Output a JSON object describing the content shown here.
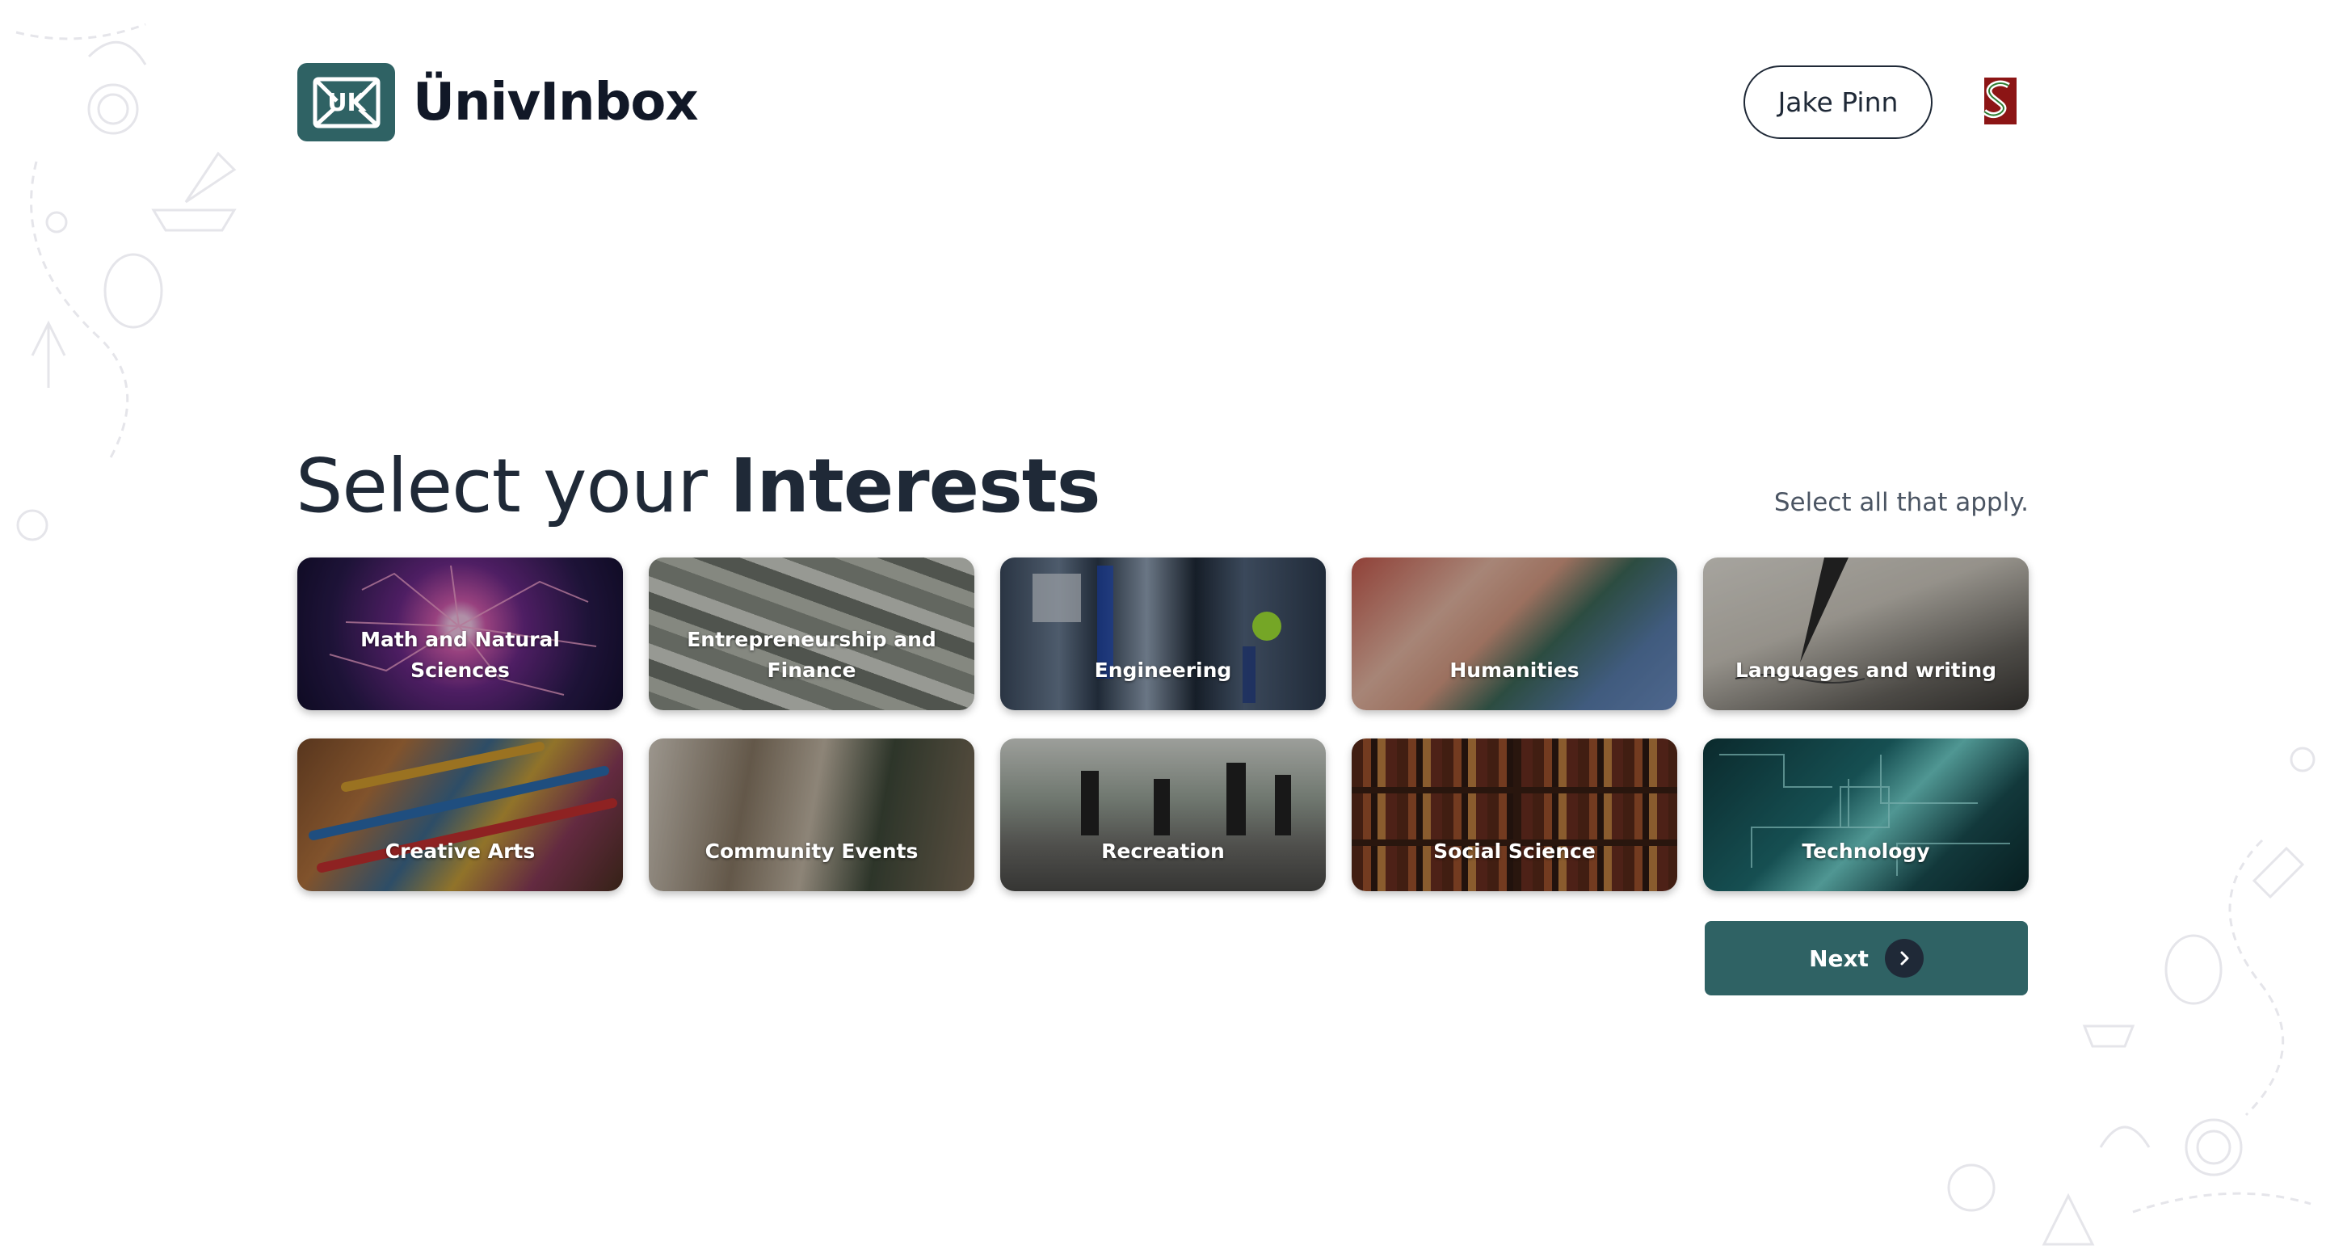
{
  "app": {
    "logo_text": "ÜnivInbox",
    "logo_icon": "envelope-uk-icon"
  },
  "header": {
    "user_name": "Jake Pinn",
    "school_logo": "stanford-s-logo-icon"
  },
  "page": {
    "title_prefix": "Select your ",
    "title_bold": "Interests",
    "hint": "Select all that apply."
  },
  "interests": [
    {
      "label": "Math and Natural Sciences",
      "image": "plasma-ball"
    },
    {
      "label": "Entrepreneurship and Finance",
      "image": "dollar-bills"
    },
    {
      "label": "Engineering",
      "image": "lab-machinery"
    },
    {
      "label": "Humanities",
      "image": "stacked-hands"
    },
    {
      "label": "Languages and writing",
      "image": "fountain-pen-writing"
    },
    {
      "label": "Creative Arts",
      "image": "paint-brushes"
    },
    {
      "label": "Community Events",
      "image": "people-at-table"
    },
    {
      "label": "Recreation",
      "image": "people-running"
    },
    {
      "label": "Social Science",
      "image": "bookshelves"
    },
    {
      "label": "Technology",
      "image": "circuit-board"
    }
  ],
  "actions": {
    "next_label": "Next",
    "next_icon": "chevron-right-icon"
  },
  "colors": {
    "brand": "#2f6264",
    "text": "#1f2937"
  }
}
